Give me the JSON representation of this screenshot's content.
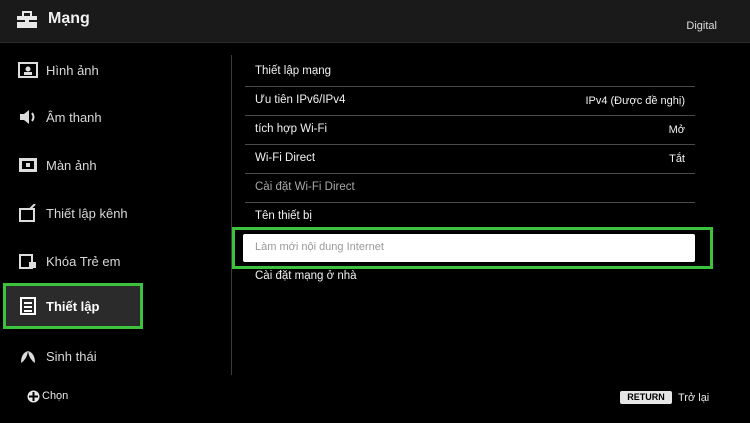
{
  "header": {
    "title": "Mạng",
    "source": "Digital",
    "icon": "toolbox-icon"
  },
  "sidebar": {
    "items": [
      {
        "label": "Hình ảnh",
        "icon": "picture-icon"
      },
      {
        "label": "Âm thanh",
        "icon": "speaker-icon"
      },
      {
        "label": "Màn ảnh",
        "icon": "screen-icon"
      },
      {
        "label": "Thiết lập kênh",
        "icon": "antenna-icon"
      },
      {
        "label": "Khóa Trẻ em",
        "icon": "lock-icon"
      },
      {
        "label": "Thiết lập",
        "icon": "settings-list-icon",
        "active": true
      },
      {
        "label": "Sinh thái",
        "icon": "eco-icon"
      }
    ]
  },
  "settings": {
    "rows": [
      {
        "label": "Thiết lập mạng",
        "value": ""
      },
      {
        "label": "Ưu tiên IPv6/IPv4",
        "value": "IPv4 (Được đề nghị)"
      },
      {
        "label": "tích hợp Wi-Fi",
        "value": "Mở"
      },
      {
        "label": "Wi-Fi Direct",
        "value": "Tắt"
      },
      {
        "label": "Cài đặt Wi-Fi Direct",
        "value": "",
        "dim": true
      },
      {
        "label": "Tên thiết bị",
        "value": ""
      }
    ],
    "focused": {
      "label": "Làm mới nội dung Internet"
    },
    "last": {
      "label": "Cài đặt mạng ở nhà"
    }
  },
  "footer": {
    "select_label": "Chọn",
    "return_key": "RETURN",
    "back_label": "Trở lại"
  },
  "colors": {
    "accent": "#3cc23c",
    "background": "#000000",
    "header": "#1a1a1a"
  }
}
